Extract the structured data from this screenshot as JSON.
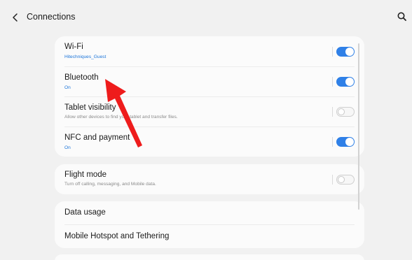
{
  "header": {
    "back_icon": "chevron-left-icon",
    "title": "Connections",
    "search_icon": "search-icon"
  },
  "settings": [
    {
      "label": "Wi-Fi",
      "sub": "Hitechniques_Guest",
      "toggle": true
    },
    {
      "label": "Bluetooth",
      "sub": "On",
      "toggle": true
    },
    {
      "label": "Tablet visibility",
      "sub": "Allow other devices to find your tablet and transfer files.",
      "toggle": false
    },
    {
      "label": "NFC and payment",
      "sub": "On",
      "toggle": true
    },
    {
      "label": "Flight mode",
      "sub": "Turn off calling, messaging, and Mobile data.",
      "toggle": false
    },
    {
      "label": "Data usage"
    },
    {
      "label": "Mobile Hotspot and Tethering"
    }
  ],
  "colors": {
    "accent": "#2f80e7",
    "annotation_arrow": "#ee1c1c"
  }
}
